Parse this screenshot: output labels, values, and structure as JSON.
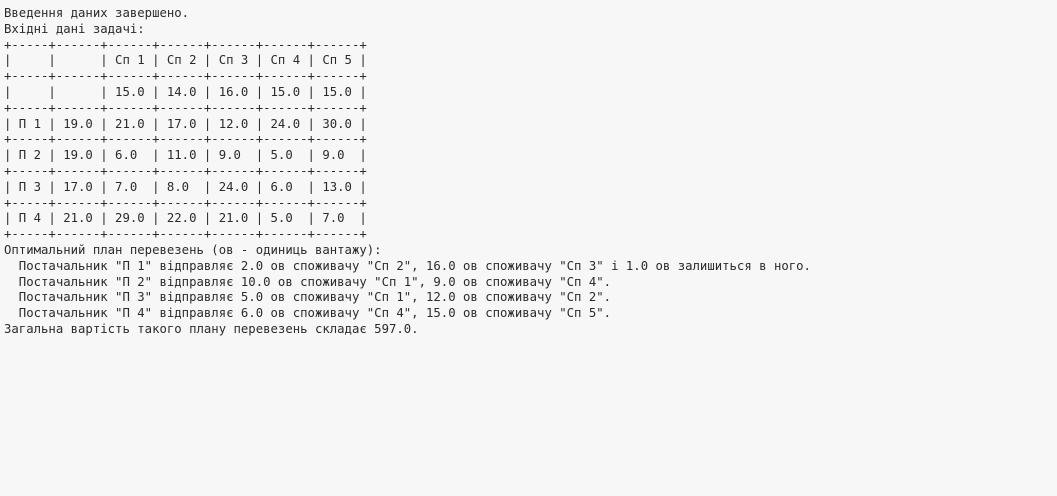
{
  "console": {
    "status_line": "Введення даних завершено.",
    "input_title": "Вхідні дані задачі:",
    "table_lines": [
      "+-----+------+------+------+------+------+------+",
      "|     |      | Сп 1 | Сп 2 | Сп 3 | Сп 4 | Сп 5 |",
      "+-----+------+------+------+------+------+------+",
      "|     |      | 15.0 | 14.0 | 16.0 | 15.0 | 15.0 |",
      "+-----+------+------+------+------+------+------+",
      "| П 1 | 19.0 | 21.0 | 17.0 | 12.0 | 24.0 | 30.0 |",
      "+-----+------+------+------+------+------+------+",
      "| П 2 | 19.0 | 6.0  | 11.0 | 9.0  | 5.0  | 9.0  |",
      "+-----+------+------+------+------+------+------+",
      "| П 3 | 17.0 | 7.0  | 8.0  | 24.0 | 6.0  | 13.0 |",
      "+-----+------+------+------+------+------+------+",
      "| П 4 | 21.0 | 29.0 | 22.0 | 21.0 | 5.0  | 7.0  |",
      "+-----+------+------+------+------+------+------+"
    ],
    "plan_title": "Оптимальний план перевезень (ов - одиниць вантажу):",
    "plan_lines": [
      "  Постачальник \"П 1\" відправляє 2.0 ов споживачу \"Сп 2\", 16.0 ов споживачу \"Сп 3\" і 1.0 ов залишиться в ного.",
      "  Постачальник \"П 2\" відправляє 10.0 ов споживачу \"Сп 1\", 9.0 ов споживачу \"Сп 4\".",
      "  Постачальник \"П 3\" відправляє 5.0 ов споживачу \"Сп 1\", 12.0 ов споживачу \"Сп 2\".",
      "  Постачальник \"П 4\" відправляє 6.0 ов споживачу \"Сп 4\", 15.0 ов споживачу \"Сп 5\"."
    ],
    "total_line": "Загальна вартість такого плану перевезень складає 597.0."
  }
}
